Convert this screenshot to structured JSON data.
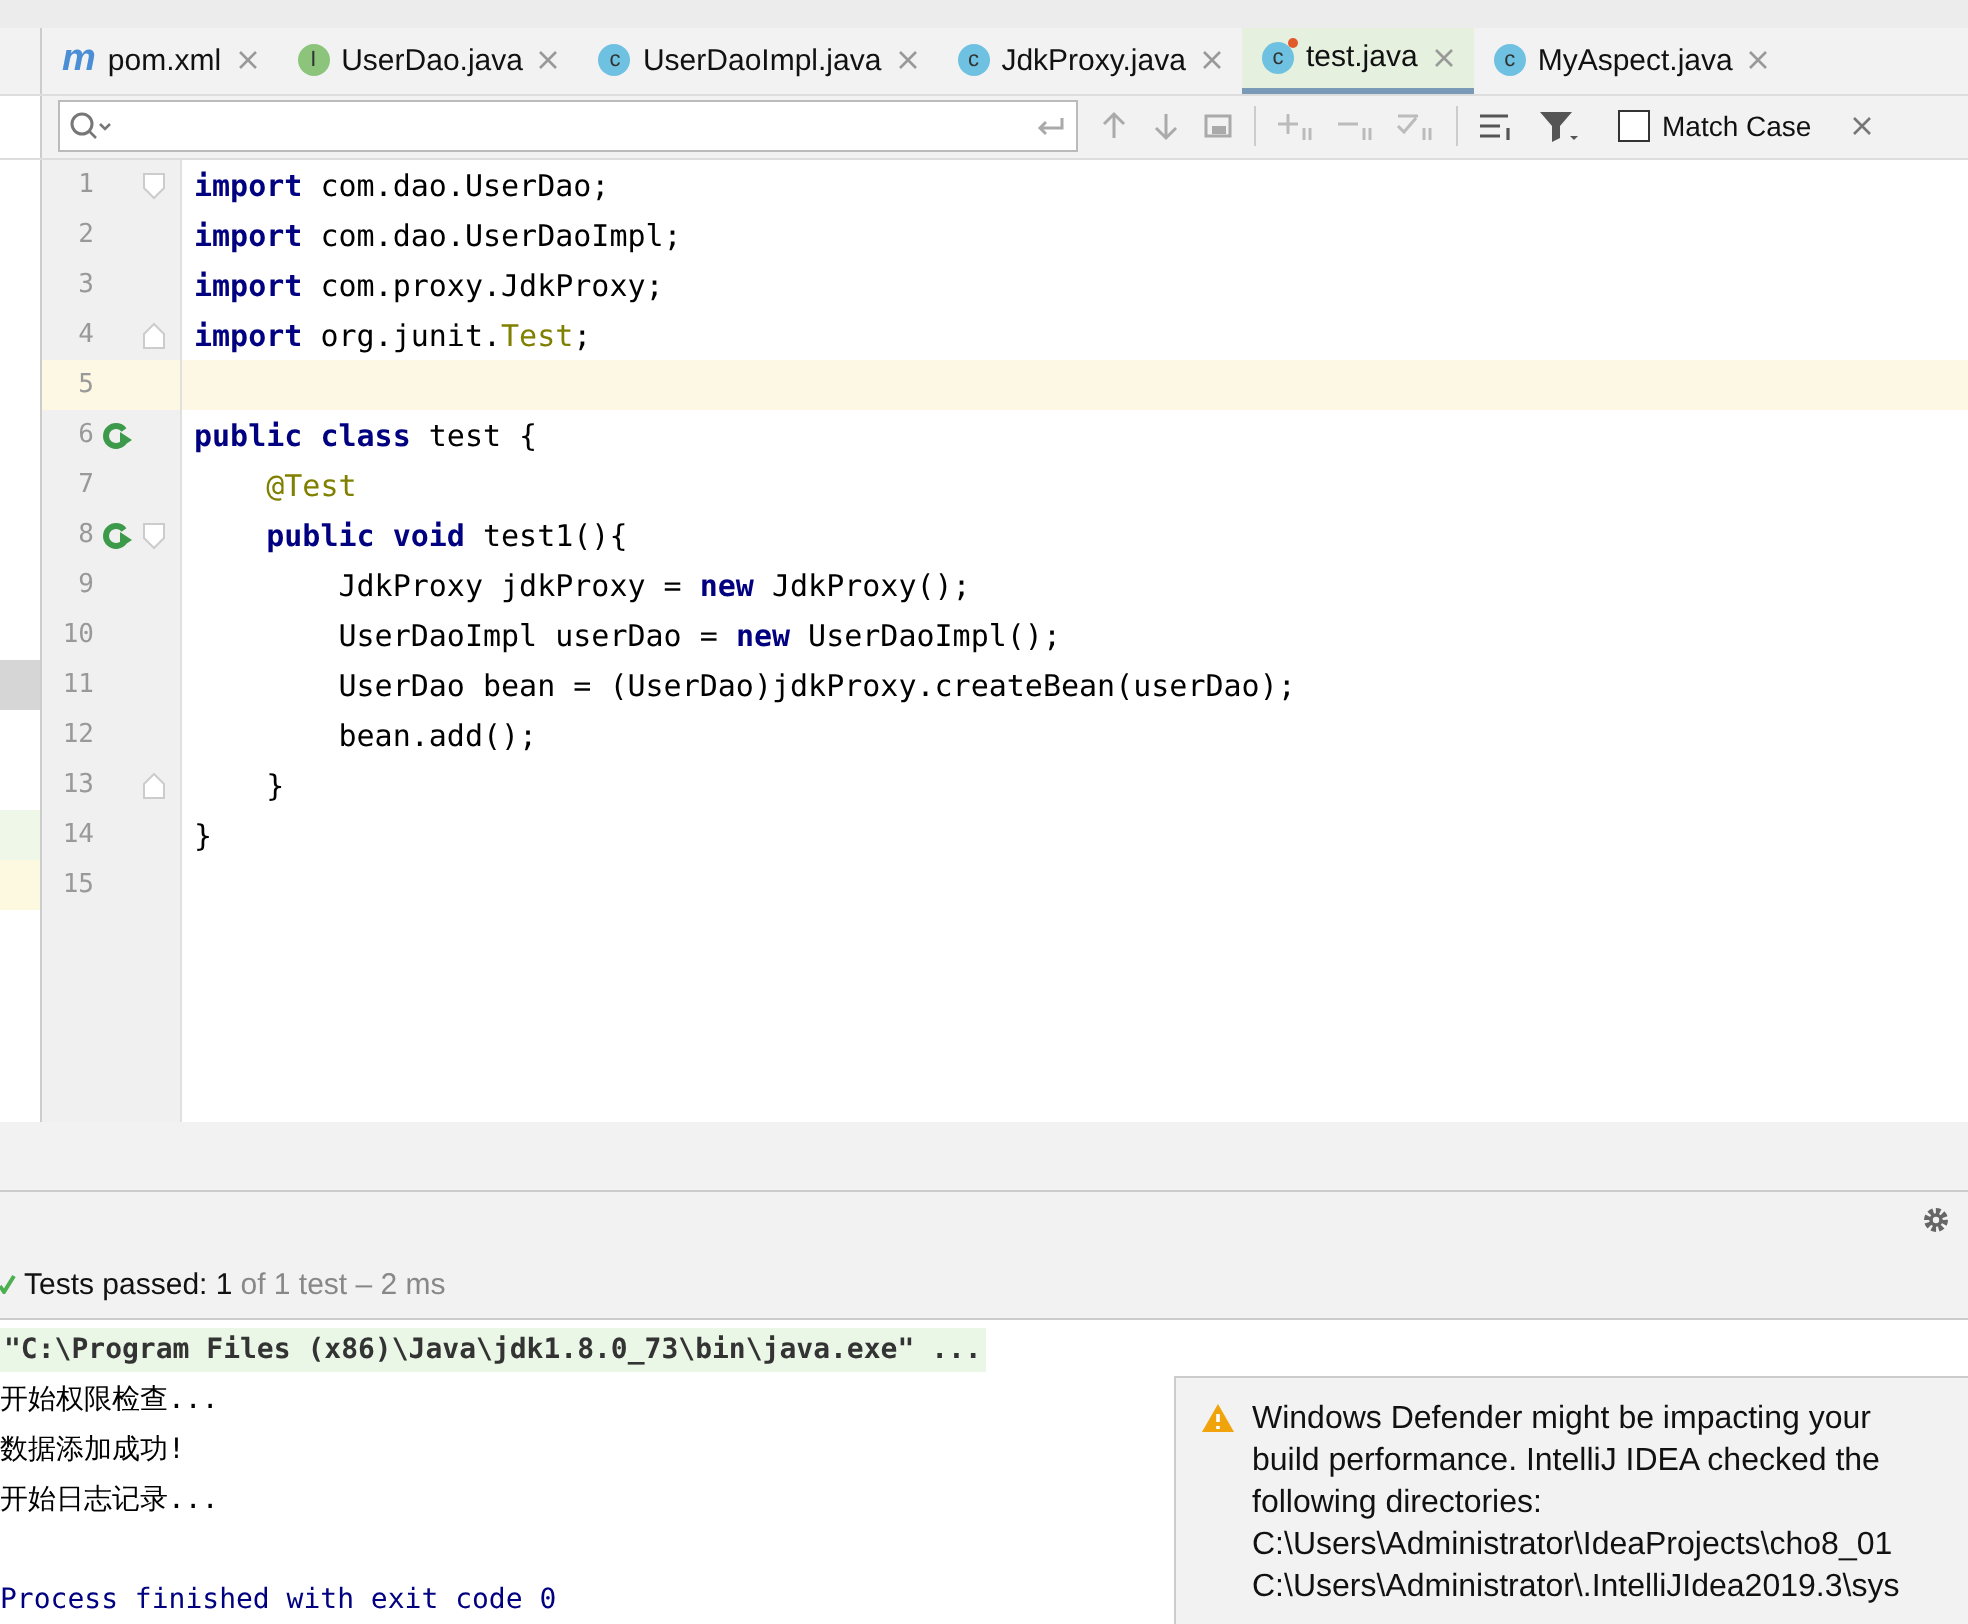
{
  "tabs": [
    {
      "label": "pom.xml",
      "kind": "maven",
      "badge": "m",
      "selected": false
    },
    {
      "label": "UserDao.java",
      "kind": "interface",
      "badge": "I",
      "selected": false
    },
    {
      "label": "UserDaoImpl.java",
      "kind": "class",
      "badge": "c",
      "selected": false
    },
    {
      "label": "JdkProxy.java",
      "kind": "class",
      "badge": "c",
      "selected": false
    },
    {
      "label": "test.java",
      "kind": "test",
      "badge": "c",
      "selected": true
    },
    {
      "label": "MyAspect.java",
      "kind": "class",
      "badge": "c",
      "selected": false
    }
  ],
  "search": {
    "match_case": {
      "label": "Match Case",
      "checked": false
    }
  },
  "editor": {
    "lines": [
      {
        "number": "1",
        "fold_start": true,
        "current": false,
        "segments": [
          {
            "kind": "kw",
            "text": "import"
          },
          {
            "kind": "plain",
            "text": " com.dao.UserDao;"
          }
        ]
      },
      {
        "number": "2",
        "current": false,
        "segments": [
          {
            "kind": "kw",
            "text": "import"
          },
          {
            "kind": "plain",
            "text": " com.dao.UserDaoImpl;"
          }
        ]
      },
      {
        "number": "3",
        "current": false,
        "segments": [
          {
            "kind": "kw",
            "text": "import"
          },
          {
            "kind": "plain",
            "text": " com.proxy.JdkProxy;"
          }
        ]
      },
      {
        "number": "4",
        "fold_end": true,
        "current": false,
        "segments": [
          {
            "kind": "kw",
            "text": "import"
          },
          {
            "kind": "plain",
            "text": " org.junit."
          },
          {
            "kind": "ann",
            "text": "Test"
          },
          {
            "kind": "plain",
            "text": ";"
          }
        ]
      },
      {
        "number": "5",
        "current": true
      },
      {
        "number": "6",
        "runnable": true,
        "current": false,
        "segments": [
          {
            "kind": "kw",
            "text": "public class"
          },
          {
            "kind": "plain",
            "text": " test {"
          }
        ]
      },
      {
        "number": "7",
        "current": false,
        "segments": [
          {
            "kind": "ann",
            "text": "    @Test"
          }
        ]
      },
      {
        "number": "8",
        "fold_start": true,
        "runnable": true,
        "current": false,
        "segments": [
          {
            "kind": "kw",
            "text": "    public void"
          },
          {
            "kind": "plain",
            "text": " test1(){"
          }
        ]
      },
      {
        "number": "9",
        "current": false,
        "segments": [
          {
            "kind": "plain",
            "text": "        JdkProxy jdkProxy = "
          },
          {
            "kind": "kw",
            "text": "new"
          },
          {
            "kind": "plain",
            "text": " JdkProxy();"
          }
        ]
      },
      {
        "number": "10",
        "current": false,
        "segments": [
          {
            "kind": "plain",
            "text": "        UserDaoImpl userDao = "
          },
          {
            "kind": "kw",
            "text": "new"
          },
          {
            "kind": "plain",
            "text": " UserDaoImpl();"
          }
        ]
      },
      {
        "number": "11",
        "current": false,
        "segments": [
          {
            "kind": "plain",
            "text": "        UserDao bean = (UserDao)jdkProxy.createBean(userDao);"
          }
        ]
      },
      {
        "number": "12",
        "current": false,
        "segments": [
          {
            "kind": "plain",
            "text": "        bean.add();"
          }
        ]
      },
      {
        "number": "13",
        "fold_end": true,
        "current": false,
        "segments": [
          {
            "kind": "plain",
            "text": "    }"
          }
        ]
      },
      {
        "number": "14",
        "current": false,
        "segments": [
          {
            "kind": "plain",
            "text": "}"
          }
        ]
      },
      {
        "number": "15",
        "current": false
      }
    ]
  },
  "test_status": {
    "summary": "Tests passed: 1",
    "detail": "of 1 test – 2 ms"
  },
  "console": [
    {
      "kind": "command",
      "text": "\"C:\\Program Files (x86)\\Java\\jdk1.8.0_73\\bin\\java.exe\" ..."
    },
    {
      "kind": "output",
      "text": "开始权限检查..."
    },
    {
      "kind": "output",
      "text": "数据添加成功!"
    },
    {
      "kind": "output",
      "text": "开始日志记录..."
    },
    {
      "kind": "blank"
    },
    {
      "kind": "exit",
      "text": "Process finished with exit code 0"
    }
  ],
  "notification": {
    "message": "Windows Defender might be impacting your build performance. IntelliJ IDEA checked the following directories:",
    "paths": [
      "C:\\Users\\Administrator\\IdeaProjects\\cho8_01",
      "C:\\Users\\Administrator\\.IntelliJIdea2019.3\\sys"
    ]
  }
}
